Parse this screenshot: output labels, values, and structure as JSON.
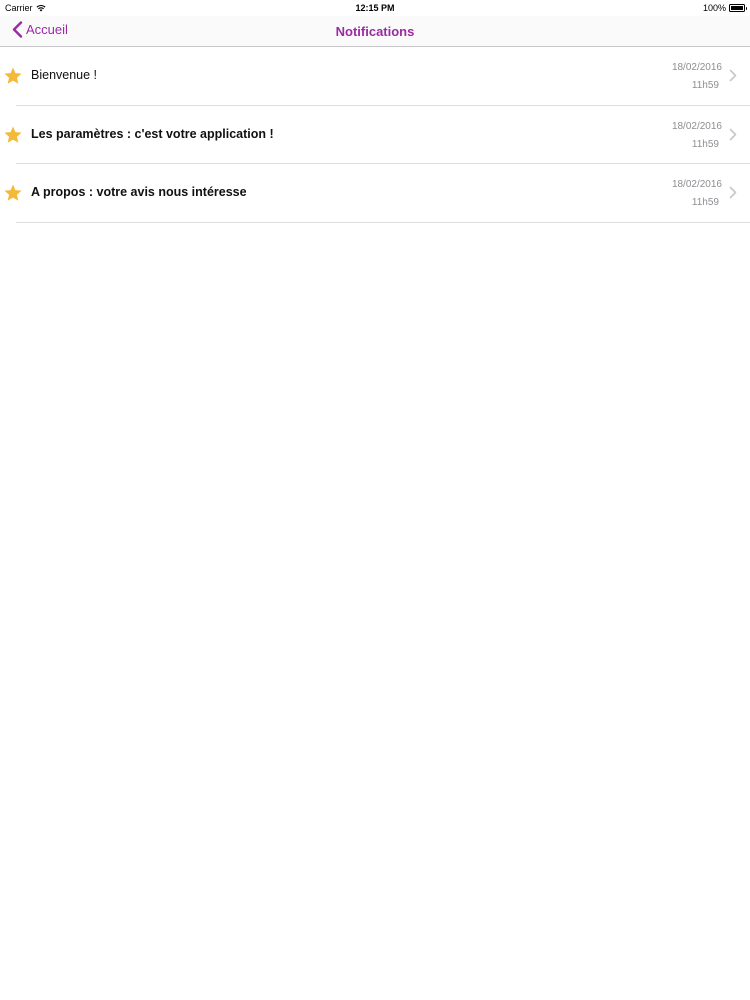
{
  "status_bar": {
    "carrier": "Carrier",
    "time": "12:15 PM",
    "battery": "100%",
    "battery_level": 1.0
  },
  "nav": {
    "back_label": "Accueil",
    "title": "Notifications",
    "accent_color": "#9b2aa3"
  },
  "notifications": [
    {
      "title": "Bienvenue !",
      "date": "18/02/2016",
      "time": "11h59",
      "icon": "star-icon",
      "bold": false
    },
    {
      "title": "Les paramètres : c'est votre application !",
      "date": "18/02/2016",
      "time": "11h59",
      "icon": "star-icon",
      "bold": true
    },
    {
      "title": "A propos : votre avis nous intéresse",
      "date": "18/02/2016",
      "time": "11h59",
      "icon": "star-icon",
      "bold": true
    }
  ],
  "colors": {
    "star": "#f5b93a",
    "secondary_text": "#8e8e93",
    "chevron": "#c7c7cc"
  }
}
